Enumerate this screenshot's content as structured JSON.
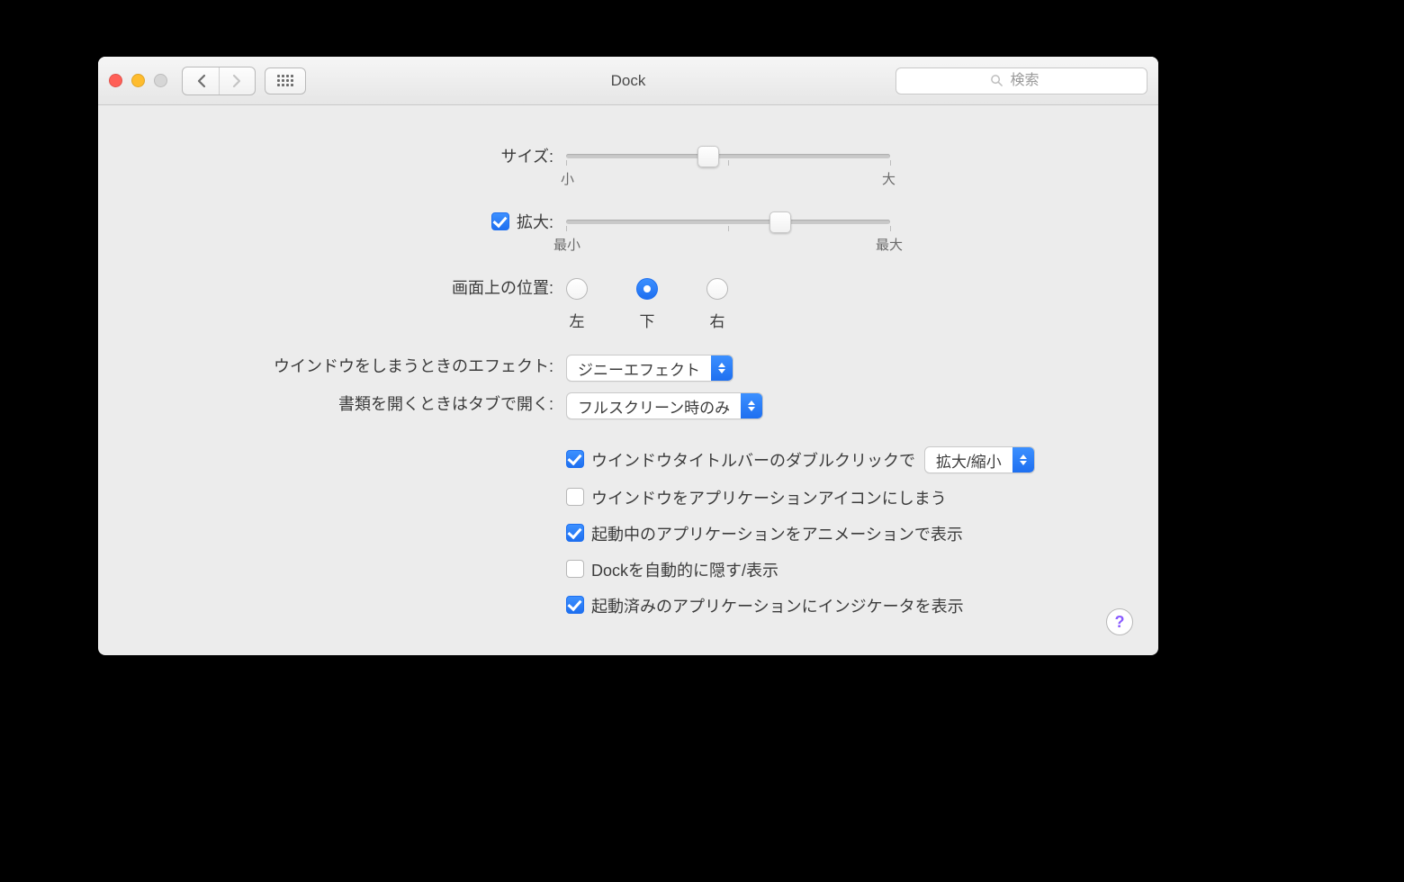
{
  "window": {
    "title": "Dock"
  },
  "toolbar": {
    "search_placeholder": "検索"
  },
  "size": {
    "label": "サイズ:",
    "min_label": "小",
    "max_label": "大",
    "value_percent": 44
  },
  "magnify": {
    "checkbox_label": "拡大:",
    "checked": true,
    "min_label": "最小",
    "max_label": "最大",
    "value_percent": 66
  },
  "position": {
    "label": "画面上の位置:",
    "options": [
      {
        "value": "left",
        "label": "左",
        "selected": false
      },
      {
        "value": "bottom",
        "label": "下",
        "selected": true
      },
      {
        "value": "right",
        "label": "右",
        "selected": false
      }
    ]
  },
  "minimize_effect": {
    "label": "ウインドウをしまうときのエフェクト:",
    "selected": "ジニーエフェクト"
  },
  "open_in_tabs": {
    "label": "書類を開くときはタブで開く:",
    "selected": "フルスクリーン時のみ"
  },
  "dblclick": {
    "checked": true,
    "label": "ウインドウタイトルバーのダブルクリックで",
    "action_selected": "拡大/縮小"
  },
  "options": {
    "minimize_to_app": {
      "checked": false,
      "label": "ウインドウをアプリケーションアイコンにしまう"
    },
    "animate_open": {
      "checked": true,
      "label": "起動中のアプリケーションをアニメーションで表示"
    },
    "autohide": {
      "checked": false,
      "label": "Dockを自動的に隠す/表示"
    },
    "show_indicators": {
      "checked": true,
      "label": "起動済みのアプリケーションにインジケータを表示"
    }
  },
  "help": "?"
}
